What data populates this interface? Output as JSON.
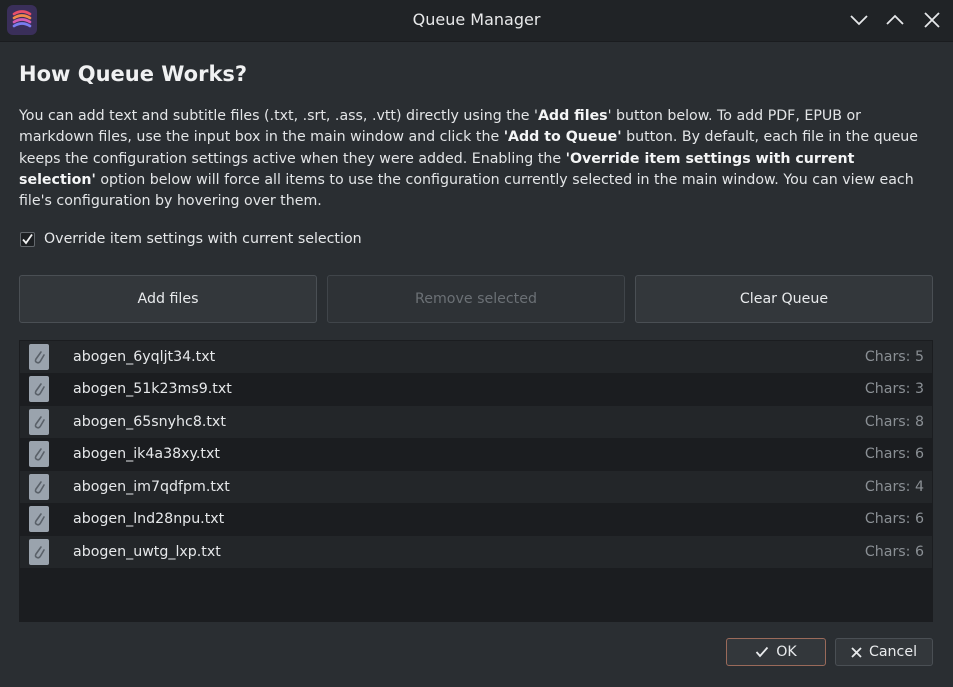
{
  "window": {
    "title": "Queue Manager",
    "app_icon": "layers-app-icon",
    "controls": [
      "minimize-icon",
      "maximize-icon",
      "close-icon"
    ]
  },
  "heading": "How Queue Works?",
  "description": {
    "p1": "You can add text and subtitle files (.txt, .srt, .ass, .vtt) directly using the '",
    "b1": "Add files",
    "p2": "' button below. To add PDF, EPUB or markdown files, use the input box in the main window and click the ",
    "b2": "'Add to Queue'",
    "p3": " button. By default, each file in the queue keeps the configuration settings active when they were added. Enabling the ",
    "b3": "'Override item settings with current selection'",
    "p4": " option below will force all items to use the configuration currently selected in the main window. You can view each file's configuration by hovering over them."
  },
  "override": {
    "label": "Override item settings with current selection",
    "checked": true
  },
  "actions": {
    "add": "Add files",
    "remove": "Remove selected",
    "clear": "Clear Queue"
  },
  "queue": [
    {
      "name": "abogen_6yqljt34.txt",
      "chars": "Chars: 5"
    },
    {
      "name": "abogen_51k23ms9.txt",
      "chars": "Chars: 3"
    },
    {
      "name": "abogen_65snyhc8.txt",
      "chars": "Chars: 8"
    },
    {
      "name": "abogen_ik4a38xy.txt",
      "chars": "Chars: 6"
    },
    {
      "name": "abogen_im7qdfpm.txt",
      "chars": "Chars: 4"
    },
    {
      "name": "abogen_lnd28npu.txt",
      "chars": "Chars: 6"
    },
    {
      "name": "abogen_uwtg_lxp.txt",
      "chars": "Chars: 6"
    }
  ],
  "dialog": {
    "ok": "OK",
    "cancel": "Cancel"
  },
  "colors": {
    "background": "#2a2e32",
    "titlebar": "#202326",
    "list_bg": "#1b1d20",
    "row_alt": "#232629",
    "ok_border": "#9a6a5a"
  }
}
